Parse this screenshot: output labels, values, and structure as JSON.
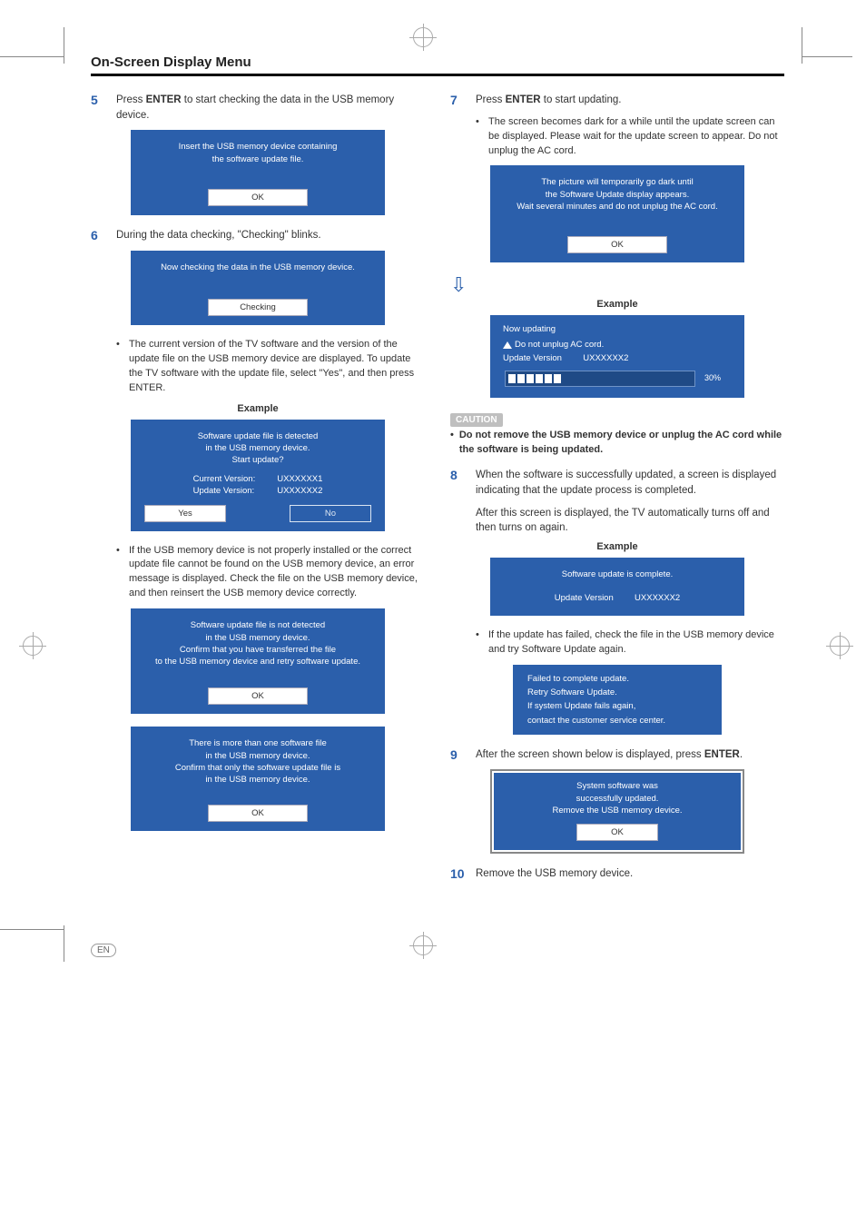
{
  "title": "On-Screen Display Menu",
  "left": {
    "step5_num": "5",
    "step5_text_a": "Press ",
    "step5_text_bold": "ENTER",
    "step5_text_b": " to start checking the data in the USB memory device.",
    "panel5_line1": "Insert the USB memory device containing",
    "panel5_line2": "the software update file.",
    "ok": "OK",
    "step6_num": "6",
    "step6_text": "During the data checking, \"Checking\" blinks.",
    "panel6_line1": "Now checking the data in the USB memory device.",
    "checking": "Checking",
    "bullet6_text": "The current version of the TV software and the version of the update file on the USB memory device are displayed. To update the TV software with the update file, select \"Yes\", and then press ",
    "bullet6_bold": "ENTER",
    "bullet6_dot": ".",
    "example": "Example",
    "panelEx_line1": "Software update file is detected",
    "panelEx_line2": "in the USB memory device.",
    "panelEx_line3": "Start update?",
    "cur_ver_label": "Current Version:",
    "cur_ver_val": "UXXXXXX1",
    "upd_ver_label": "Update Version:",
    "upd_ver_val": "UXXXXXX2",
    "yes": "Yes",
    "no": "No",
    "bulletErr_text": "If the USB memory device is not properly installed or the correct update file cannot be found on the USB memory device, an error message is displayed. Check the file on the USB memory device, and then reinsert the USB memory device correctly.",
    "panelErrA_l1": "Software update file is not detected",
    "panelErrA_l2": "in the USB memory device.",
    "panelErrA_l3": "Confirm that you have transferred the file",
    "panelErrA_l4": "to the USB memory device and retry software update.",
    "panelErrB_l1": "There is more than one software file",
    "panelErrB_l2": "in the USB memory device.",
    "panelErrB_l3": "Confirm that only the software update file is",
    "panelErrB_l4": "in the USB memory device."
  },
  "right": {
    "step7_num": "7",
    "step7_text_a": "Press ",
    "step7_text_bold": "ENTER",
    "step7_text_b": " to start updating.",
    "bullet7_text": "The screen becomes dark for a while until the update screen can be displayed. Please wait for the update screen to appear. Do not unplug the AC cord.",
    "panel7_l1": "The picture will temporarily go dark until",
    "panel7_l2": "the Software Update display appears.",
    "panel7_l3": "Wait several minutes and do not unplug the AC cord.",
    "ok": "OK",
    "example": "Example",
    "now_updating": "Now updating",
    "do_not_unplug": "Do not unplug AC cord.",
    "upd_ver_label": "Update Version",
    "upd_ver_val": "UXXXXXX2",
    "progress_pct": "30%",
    "caution_tag": "CAUTION",
    "caution_text": "Do not remove the USB memory device or unplug the AC cord while the software is being updated.",
    "step8_num": "8",
    "step8_text": "When the software is successfully updated, a screen is displayed indicating that the update process is completed.",
    "step8_after": "After this screen is displayed, the TV automatically turns off and then turns on again.",
    "panel8_l1": "Software update is complete.",
    "bullet8_text": "If the update has failed, check the file in the USB memory device and try Software Update again.",
    "panelFail_l1": "Failed to complete update.",
    "panelFail_l2": "Retry Software Update.",
    "panelFail_l3": "If system Update fails again,",
    "panelFail_l4": "contact the customer service center.",
    "step9_num": "9",
    "step9_text_a": "After the screen shown below is displayed, press ",
    "step9_text_bold": "ENTER",
    "step9_dot": ".",
    "panel9_l1": "System software was",
    "panel9_l2": "successfully updated.",
    "panel9_l3": "Remove the USB memory device.",
    "step10_num": "10",
    "step10_text": "Remove the USB memory device."
  },
  "footer_en": "EN"
}
